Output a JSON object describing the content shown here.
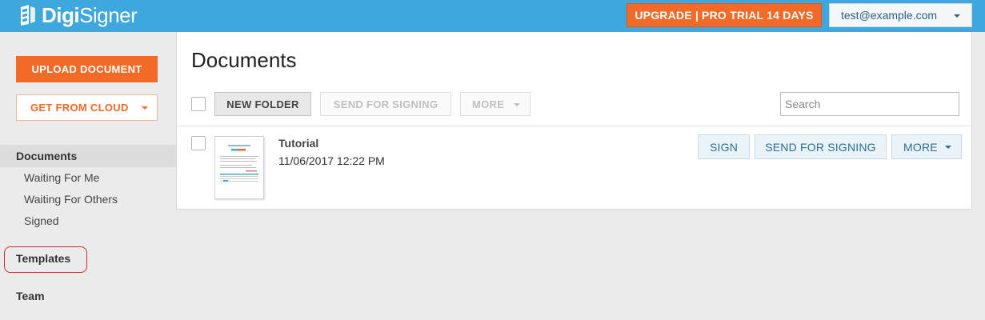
{
  "header": {
    "logo_bold": "Digi",
    "logo_light": "Signer",
    "upgrade_label": "UPGRADE | PRO TRIAL 14 DAYS",
    "user_email": "test@example.com"
  },
  "sidebar": {
    "upload_label": "UPLOAD DOCUMENT",
    "cloud_label": "GET FROM CLOUD",
    "documents_label": "Documents",
    "sub_items": [
      {
        "label": "Waiting For Me"
      },
      {
        "label": "Waiting For Others"
      },
      {
        "label": "Signed"
      }
    ],
    "templates_label": "Templates",
    "team_label": "Team"
  },
  "main": {
    "title": "Documents",
    "toolbar": {
      "new_folder_label": "NEW FOLDER",
      "send_label": "SEND FOR SIGNING",
      "more_label": "MORE",
      "search_placeholder": "Search"
    },
    "documents": [
      {
        "name": "Tutorial",
        "date": "11/06/2017 12:22 PM",
        "sign_label": "SIGN",
        "send_label": "SEND FOR SIGNING",
        "more_label": "MORE"
      }
    ]
  },
  "colors": {
    "header_bg": "#3ea8de",
    "accent_orange": "#f26a28",
    "action_blue": "#2c6f99",
    "highlight_red": "#d9262f"
  }
}
